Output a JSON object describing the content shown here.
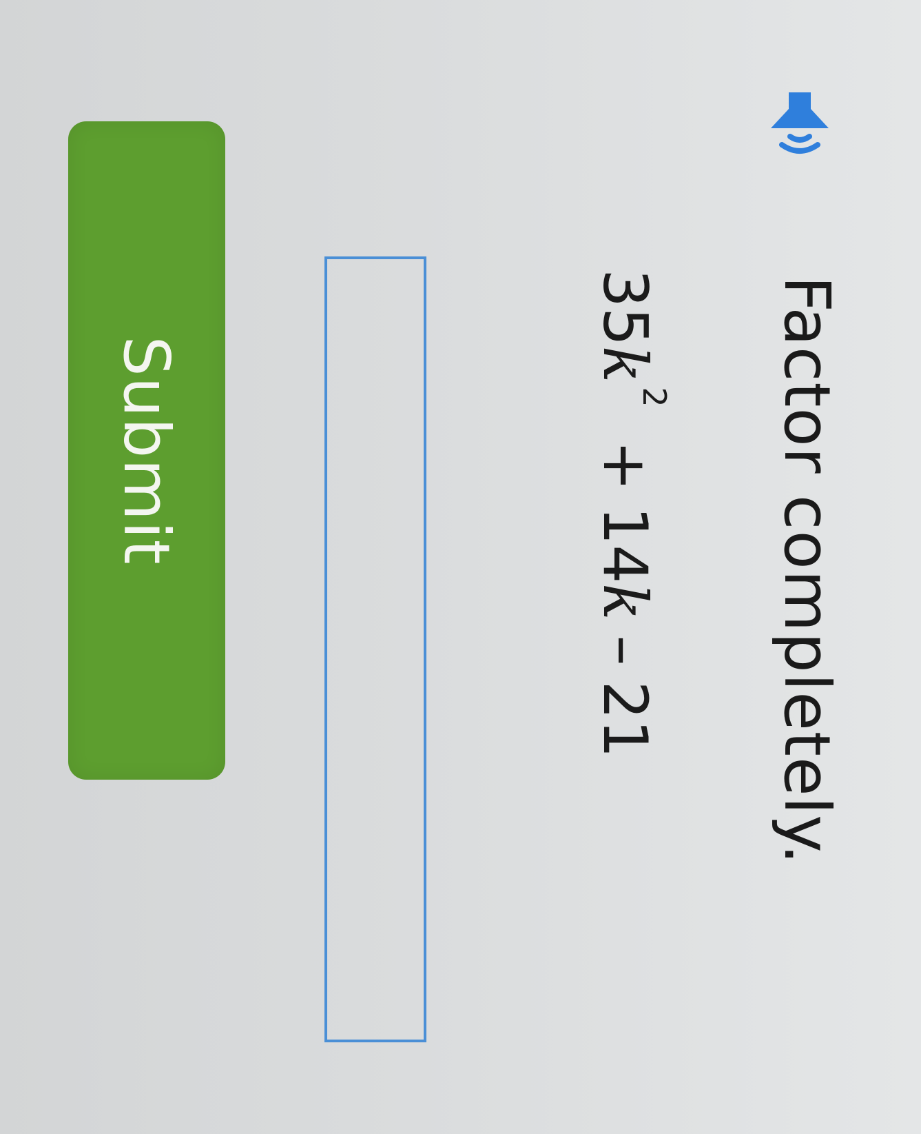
{
  "question": {
    "prompt": "Factor completely.",
    "speaker_icon": "speaker-icon",
    "expression": {
      "term1_coef": "35",
      "term1_var": "k",
      "term1_exp": "2",
      "op1": "+",
      "term2_coef": "14",
      "term2_var": "k",
      "op2": "–",
      "term3": "21"
    }
  },
  "answer": {
    "value": ""
  },
  "actions": {
    "submit_label": "Submit"
  },
  "colors": {
    "submit_bg": "#5d9e2f",
    "input_border": "#4a8fd6",
    "speaker": "#2f7fdc"
  }
}
